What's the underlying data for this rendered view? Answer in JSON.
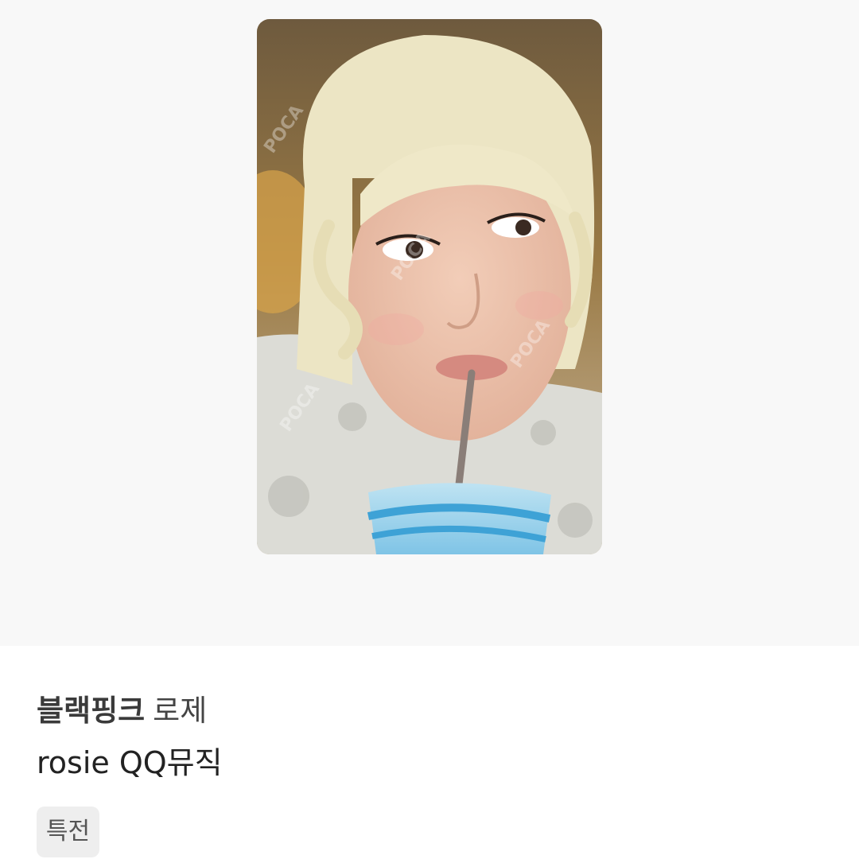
{
  "product": {
    "image_alt": "photocard",
    "group": "블랙핑크",
    "member": "로제",
    "subtitle": "rosie QQ뮤직",
    "tag": "특전"
  },
  "colors": {
    "hero_background": "#f8f8f8",
    "tag_background": "#eeeeee",
    "text_primary": "#222222"
  }
}
